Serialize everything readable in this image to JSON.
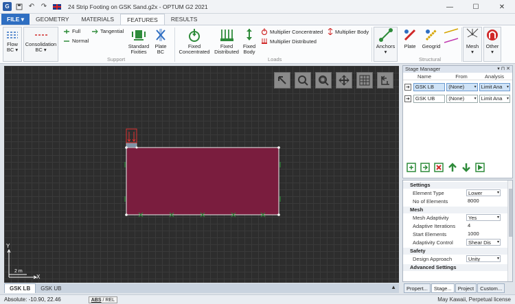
{
  "titlebar": {
    "title": "24 Strip Footing on GSK Sand.g2x - OPTUM G2 2021",
    "logo": "G"
  },
  "tabs": [
    "FILE ▾",
    "GEOMETRY",
    "MATERIALS",
    "FEATURES",
    "RESULTS"
  ],
  "active_tab": "FEATURES",
  "ribbon": {
    "flow_bc": "Flow\nBC ▾",
    "consolidation_bc": "Consolidation\nBC ▾",
    "full": "Full",
    "tangential": "Tangential",
    "normal": "Normal",
    "standard_fixities": "Standard\nFixities",
    "plate_bc": "Plate\nBC",
    "support_label": "Support",
    "fixed_concentrated": "Fixed\nConcentrated",
    "fixed_distributed": "Fixed\nDistributed",
    "fixed_body": "Fixed\nBody",
    "multiplier_concentrated": "Multiplier Concentrated",
    "multiplier_distributed": "Multiplier Distributed",
    "multiplier_body": "Multiplier Body",
    "loads_label": "Loads",
    "anchors": "Anchors\n▾",
    "plate": "Plate",
    "geogrid": "Geogrid",
    "structural_label": "Structural",
    "mesh": "Mesh\n▾",
    "other": "Other\n▾",
    "colors": {
      "green": "#2e8b3a",
      "red": "#d02828",
      "blue": "#2f6fc2"
    }
  },
  "viewport": {
    "scale_label": "2 m",
    "x_axis": "X",
    "y_axis": "Y",
    "soil_color": "#7a1d3e"
  },
  "bottom_tabs": [
    "GSK LB",
    "GSK UB"
  ],
  "active_bottom_tab": "GSK LB",
  "status": {
    "coords": "Absolute:  -10.90, 22.46",
    "abs": "ABS",
    "rel": " / REL",
    "license": "May Kawaii, Perpetual license"
  },
  "stage_manager": {
    "title": "Stage Manager",
    "pin": "▾ ⊓ ✕",
    "columns": [
      "Name",
      "From",
      "Analysis"
    ],
    "rows": [
      {
        "name": "GSK LB",
        "from": "(None)",
        "analysis": "Limit Ana"
      },
      {
        "name": "GSK UB",
        "from": "(None)",
        "analysis": "Limit Ana"
      }
    ]
  },
  "properties": {
    "sections": [
      {
        "title": "Settings",
        "rows": [
          {
            "label": "Element Type",
            "value": "Lower",
            "dropdown": true
          },
          {
            "label": "No of Elements",
            "value": "8000",
            "dropdown": false
          }
        ]
      },
      {
        "title": "Mesh",
        "rows": [
          {
            "label": "Mesh Adaptivity",
            "value": "Yes",
            "dropdown": true
          },
          {
            "label": "Adaptive Iterations",
            "value": "4",
            "dropdown": false
          },
          {
            "label": "Start Elements",
            "value": "1000",
            "dropdown": false
          },
          {
            "label": "Adaptivity Control",
            "value": "Shear Dis",
            "dropdown": true
          }
        ]
      },
      {
        "title": "Safety",
        "rows": [
          {
            "label": "Design Approach",
            "value": "Unity",
            "dropdown": true
          }
        ]
      },
      {
        "title": "Advanced Settings",
        "rows": []
      }
    ]
  },
  "right_tabs": [
    "Propert...",
    "Stage...",
    "Project",
    "Custom..."
  ],
  "active_right_tab": "Stage..."
}
